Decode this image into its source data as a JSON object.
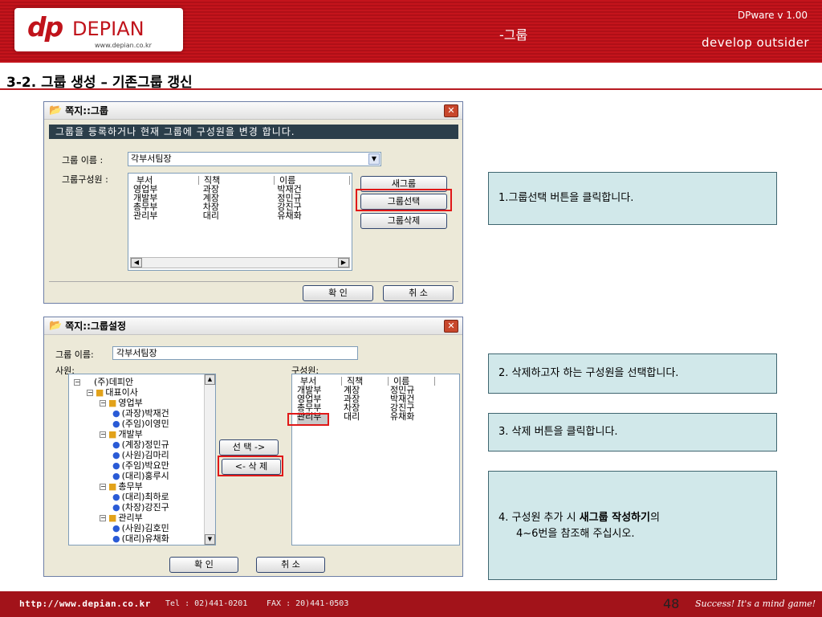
{
  "header": {
    "logo": {
      "mark": "dp",
      "name": "DEPIAN",
      "url": "www.depian.co.kr"
    },
    "section": "-그룹",
    "version": "DPware v 1.00",
    "slogan": "develop outsider",
    "accent": "#c4141c"
  },
  "page_title": "3-2. 그룹 생성 – 기존그룹 갱신",
  "window_group": {
    "title": "쪽지::그룹",
    "banner": "그룹을 등록하거나 현재 그룹에 구성원을 변경 합니다.",
    "name_label": "그룹 이름 :",
    "name_value": "각부서팀장",
    "members_label": "그룹구성원 :",
    "columns": [
      "부서",
      "직책",
      "이름"
    ],
    "rows": [
      [
        "영업부",
        "과장",
        "박재건"
      ],
      [
        "개발부",
        "계장",
        "정민규"
      ],
      [
        "총무부",
        "차장",
        "강진구"
      ],
      [
        "관리부",
        "대리",
        "유채화"
      ]
    ],
    "buttons": {
      "new": "새그룹",
      "select": "그룹선택",
      "delete": "그룹삭제",
      "ok": "확 인",
      "cancel": "취 소"
    }
  },
  "window_settings": {
    "title": "쪽지::그룹설정",
    "name_label": "그룹 이름:",
    "name_value": "각부서팀장",
    "employees_label": "사원:",
    "members_label": "구성원:",
    "tree": [
      {
        "label": "(주)데피안",
        "type": "root",
        "level": 0
      },
      {
        "label": "대표이사",
        "type": "folder",
        "level": 1
      },
      {
        "label": "영업부",
        "type": "folder",
        "level": 2
      },
      {
        "label": "(과장)박재건",
        "type": "person",
        "level": 3
      },
      {
        "label": "(주임)이영민",
        "type": "person",
        "level": 3
      },
      {
        "label": "개발부",
        "type": "folder",
        "level": 2
      },
      {
        "label": "(계장)정민규",
        "type": "person",
        "level": 3
      },
      {
        "label": "(사원)김마리",
        "type": "person",
        "level": 3
      },
      {
        "label": "(주임)박요만",
        "type": "person",
        "level": 3
      },
      {
        "label": "(대리)홍루시",
        "type": "person",
        "level": 3
      },
      {
        "label": "총무부",
        "type": "folder",
        "level": 2
      },
      {
        "label": "(대리)최하로",
        "type": "person",
        "level": 3
      },
      {
        "label": "(차장)강진구",
        "type": "person",
        "level": 3
      },
      {
        "label": "관리부",
        "type": "folder",
        "level": 2
      },
      {
        "label": "(사원)김호민",
        "type": "person",
        "level": 3
      },
      {
        "label": "(대리)유채화",
        "type": "person",
        "level": 3
      }
    ],
    "columns": [
      "부서",
      "직책",
      "이름"
    ],
    "rows": [
      [
        "개발부",
        "계장",
        "정민규"
      ],
      [
        "영업부",
        "과장",
        "박재건"
      ],
      [
        "총무부",
        "차장",
        "강진구"
      ],
      [
        "관리부",
        "대리",
        "유채화"
      ]
    ],
    "buttons": {
      "select": "선 택 ->",
      "delete": "<- 삭 제",
      "ok": "확 인",
      "cancel": "취 소"
    }
  },
  "notes": [
    {
      "text": "1.그룹선택 버튼을 클릭합니다."
    },
    {
      "text": "2. 삭제하고자 하는 구성원을 선택합니다."
    },
    {
      "text": "3. 삭제 버튼을 클릭합니다."
    },
    {
      "prefix": "4. 구성원 추가 시 ",
      "bold": "새그룹 작성하기",
      "suffix": "의",
      "line2": "4~6번을 참조해 주십시오."
    }
  ],
  "footer": {
    "url": "http://www.depian.co.kr",
    "tel": "Tel : 02)441-0201",
    "fax": "FAX : 20)441-0503",
    "page": "48",
    "motto": "Success! It's a mind game!"
  },
  "icons": {
    "window": "folder-icon",
    "close": "close-icon",
    "folder": "folder-icon",
    "person": "person-icon"
  }
}
